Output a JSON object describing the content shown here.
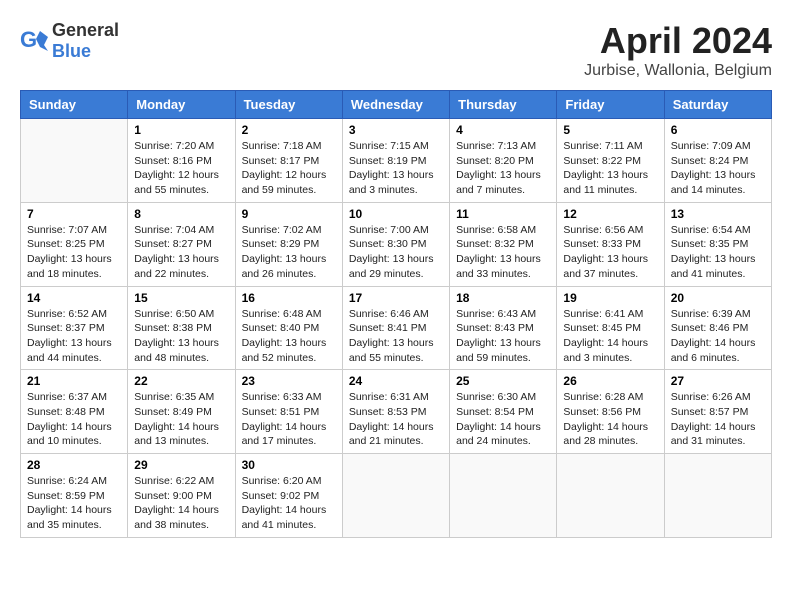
{
  "header": {
    "logo": {
      "text_general": "General",
      "text_blue": "Blue"
    },
    "title": "April 2024",
    "subtitle": "Jurbise, Wallonia, Belgium"
  },
  "calendar": {
    "days_of_week": [
      "Sunday",
      "Monday",
      "Tuesday",
      "Wednesday",
      "Thursday",
      "Friday",
      "Saturday"
    ],
    "weeks": [
      [
        {
          "day": "",
          "info": ""
        },
        {
          "day": "1",
          "info": "Sunrise: 7:20 AM\nSunset: 8:16 PM\nDaylight: 12 hours\nand 55 minutes."
        },
        {
          "day": "2",
          "info": "Sunrise: 7:18 AM\nSunset: 8:17 PM\nDaylight: 12 hours\nand 59 minutes."
        },
        {
          "day": "3",
          "info": "Sunrise: 7:15 AM\nSunset: 8:19 PM\nDaylight: 13 hours\nand 3 minutes."
        },
        {
          "day": "4",
          "info": "Sunrise: 7:13 AM\nSunset: 8:20 PM\nDaylight: 13 hours\nand 7 minutes."
        },
        {
          "day": "5",
          "info": "Sunrise: 7:11 AM\nSunset: 8:22 PM\nDaylight: 13 hours\nand 11 minutes."
        },
        {
          "day": "6",
          "info": "Sunrise: 7:09 AM\nSunset: 8:24 PM\nDaylight: 13 hours\nand 14 minutes."
        }
      ],
      [
        {
          "day": "7",
          "info": "Sunrise: 7:07 AM\nSunset: 8:25 PM\nDaylight: 13 hours\nand 18 minutes."
        },
        {
          "day": "8",
          "info": "Sunrise: 7:04 AM\nSunset: 8:27 PM\nDaylight: 13 hours\nand 22 minutes."
        },
        {
          "day": "9",
          "info": "Sunrise: 7:02 AM\nSunset: 8:29 PM\nDaylight: 13 hours\nand 26 minutes."
        },
        {
          "day": "10",
          "info": "Sunrise: 7:00 AM\nSunset: 8:30 PM\nDaylight: 13 hours\nand 29 minutes."
        },
        {
          "day": "11",
          "info": "Sunrise: 6:58 AM\nSunset: 8:32 PM\nDaylight: 13 hours\nand 33 minutes."
        },
        {
          "day": "12",
          "info": "Sunrise: 6:56 AM\nSunset: 8:33 PM\nDaylight: 13 hours\nand 37 minutes."
        },
        {
          "day": "13",
          "info": "Sunrise: 6:54 AM\nSunset: 8:35 PM\nDaylight: 13 hours\nand 41 minutes."
        }
      ],
      [
        {
          "day": "14",
          "info": "Sunrise: 6:52 AM\nSunset: 8:37 PM\nDaylight: 13 hours\nand 44 minutes."
        },
        {
          "day": "15",
          "info": "Sunrise: 6:50 AM\nSunset: 8:38 PM\nDaylight: 13 hours\nand 48 minutes."
        },
        {
          "day": "16",
          "info": "Sunrise: 6:48 AM\nSunset: 8:40 PM\nDaylight: 13 hours\nand 52 minutes."
        },
        {
          "day": "17",
          "info": "Sunrise: 6:46 AM\nSunset: 8:41 PM\nDaylight: 13 hours\nand 55 minutes."
        },
        {
          "day": "18",
          "info": "Sunrise: 6:43 AM\nSunset: 8:43 PM\nDaylight: 13 hours\nand 59 minutes."
        },
        {
          "day": "19",
          "info": "Sunrise: 6:41 AM\nSunset: 8:45 PM\nDaylight: 14 hours\nand 3 minutes."
        },
        {
          "day": "20",
          "info": "Sunrise: 6:39 AM\nSunset: 8:46 PM\nDaylight: 14 hours\nand 6 minutes."
        }
      ],
      [
        {
          "day": "21",
          "info": "Sunrise: 6:37 AM\nSunset: 8:48 PM\nDaylight: 14 hours\nand 10 minutes."
        },
        {
          "day": "22",
          "info": "Sunrise: 6:35 AM\nSunset: 8:49 PM\nDaylight: 14 hours\nand 13 minutes."
        },
        {
          "day": "23",
          "info": "Sunrise: 6:33 AM\nSunset: 8:51 PM\nDaylight: 14 hours\nand 17 minutes."
        },
        {
          "day": "24",
          "info": "Sunrise: 6:31 AM\nSunset: 8:53 PM\nDaylight: 14 hours\nand 21 minutes."
        },
        {
          "day": "25",
          "info": "Sunrise: 6:30 AM\nSunset: 8:54 PM\nDaylight: 14 hours\nand 24 minutes."
        },
        {
          "day": "26",
          "info": "Sunrise: 6:28 AM\nSunset: 8:56 PM\nDaylight: 14 hours\nand 28 minutes."
        },
        {
          "day": "27",
          "info": "Sunrise: 6:26 AM\nSunset: 8:57 PM\nDaylight: 14 hours\nand 31 minutes."
        }
      ],
      [
        {
          "day": "28",
          "info": "Sunrise: 6:24 AM\nSunset: 8:59 PM\nDaylight: 14 hours\nand 35 minutes."
        },
        {
          "day": "29",
          "info": "Sunrise: 6:22 AM\nSunset: 9:00 PM\nDaylight: 14 hours\nand 38 minutes."
        },
        {
          "day": "30",
          "info": "Sunrise: 6:20 AM\nSunset: 9:02 PM\nDaylight: 14 hours\nand 41 minutes."
        },
        {
          "day": "",
          "info": ""
        },
        {
          "day": "",
          "info": ""
        },
        {
          "day": "",
          "info": ""
        },
        {
          "day": "",
          "info": ""
        }
      ]
    ]
  }
}
